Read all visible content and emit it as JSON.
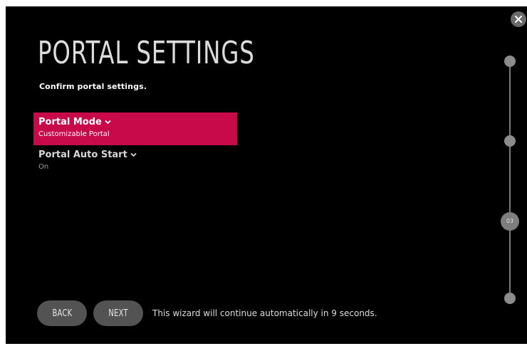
{
  "header": {
    "title": "PORTAL SETTINGS",
    "subtitle": "Confirm portal settings."
  },
  "settings": [
    {
      "label": "Portal Mode",
      "value": "Customizable Portal",
      "selected": true
    },
    {
      "label": "Portal Auto Start",
      "value": "On",
      "selected": false
    }
  ],
  "footer": {
    "back_label": "BACK",
    "next_label": "NEXT",
    "status": "This wizard will continue automatically in 9 seconds."
  },
  "progress": {
    "current_step_label": "03"
  },
  "icons": {
    "close": "close-icon",
    "dropdown": "chevron-down-icon"
  },
  "colors": {
    "accent": "#c8094a",
    "background": "#000000",
    "button": "#535353"
  }
}
